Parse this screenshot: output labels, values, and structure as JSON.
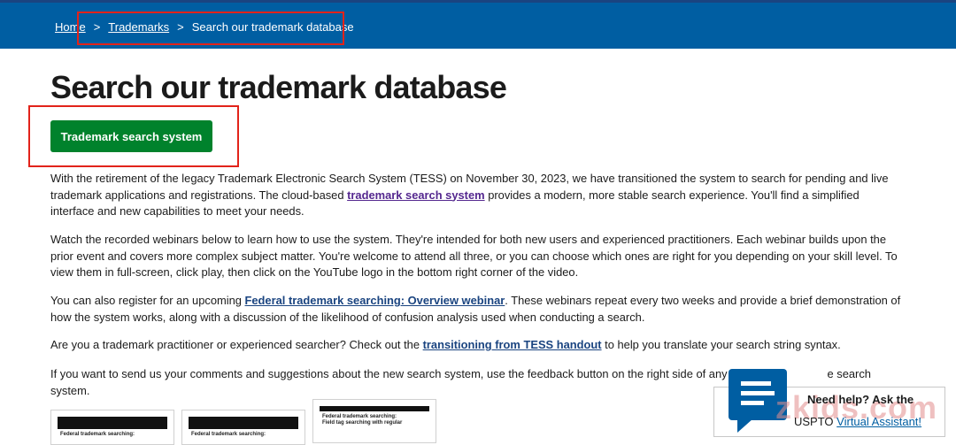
{
  "breadcrumb": {
    "home": "Home",
    "separator": ">",
    "trademarks": "Trademarks",
    "current": "Search our trademark database"
  },
  "page": {
    "title": "Search our trademark database",
    "primary_button": "Trademark search system"
  },
  "paragraphs": {
    "p1_a": "With the retirement of the legacy Trademark Electronic Search System (TESS) on November 30, 2023, we have transitioned the system to search for pending and live trademark applications and registrations. The cloud-based ",
    "p1_link": "trademark search system",
    "p1_b": " provides a modern, more stable search experience. You'll find a simplified interface and new capabilities to meet your needs.",
    "p2": "Watch the recorded webinars below to learn how to use the system. They're intended for both new users and experienced practitioners. Each webinar builds upon the prior event and covers more complex subject matter. You're welcome to attend all three, or you can choose which ones are right for you depending on your skill level. To view them in full-screen, click play, then click on the YouTube logo in the bottom right corner of the video.",
    "p3_a": "You can also register for an upcoming ",
    "p3_link": "Federal trademark searching: Overview webinar",
    "p3_b": ". These webinars repeat every two weeks and provide a brief demonstration of how the system works, along with a discussion of the likelihood of confusion analysis used when conducting a search.",
    "p4_a": "Are you a trademark practitioner or experienced searcher? Check out the ",
    "p4_link": "transitioning from TESS handout",
    "p4_b": " to help you translate your search string syntax.",
    "p5": "If you want to send us your comments and suggestions about the new search system, use the feedback button on the right side of any pa",
    "p5_end": "e search system."
  },
  "videos": [
    {
      "title": "Federal trademark searching:"
    },
    {
      "title": "Federal trademark searching:"
    },
    {
      "title": "Federal trademark searching:",
      "subtitle": "Field tag searching with regular"
    }
  ],
  "help": {
    "line1": "Need help? Ask the",
    "line2_prefix": "USPTO ",
    "line2_link": "Virtual Assistant!",
    "icon": "chat-bubble-icon"
  },
  "watermark": "zkids.com",
  "colors": {
    "header_blue": "#005ea2",
    "button_green": "#00822c",
    "annotation_red": "#e2231a",
    "link": "#1a4480",
    "visited_link": "#54278f"
  }
}
